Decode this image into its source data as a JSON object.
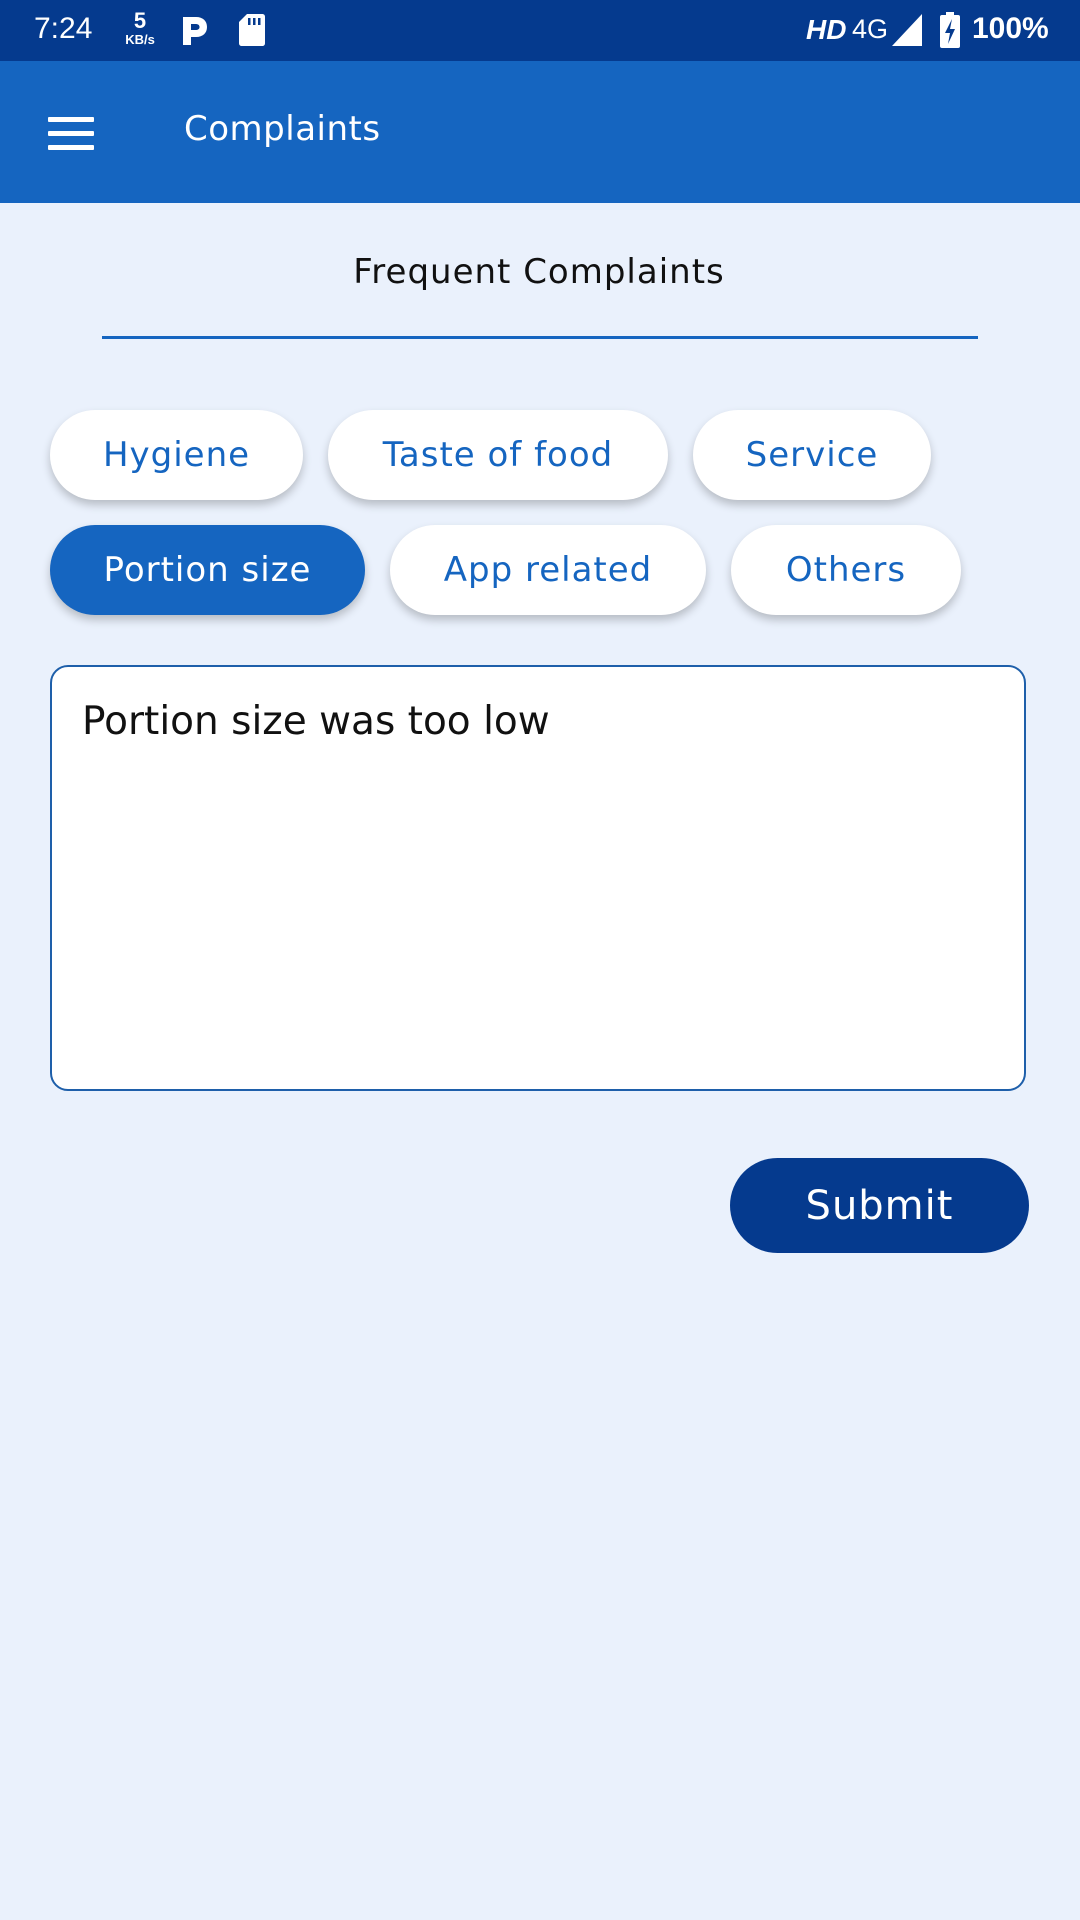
{
  "status_bar": {
    "time": "7:24",
    "net_speed_value": "5",
    "net_speed_unit": "KB/s",
    "hd_label": "HD",
    "network_type": "4G",
    "battery_percent": "100%",
    "icons": [
      "parking-app-icon",
      "sd-card-icon",
      "cell-signal-icon",
      "battery-charging-icon"
    ]
  },
  "app_bar": {
    "menu_icon": "hamburger-menu-icon",
    "title": "Complaints",
    "background_color": "#1565C0"
  },
  "section": {
    "title": "Frequent Complaints"
  },
  "chips": [
    {
      "label": "Hygiene",
      "selected": false
    },
    {
      "label": "Taste of food",
      "selected": false
    },
    {
      "label": "Service",
      "selected": false
    },
    {
      "label": "Portion size",
      "selected": true
    },
    {
      "label": "App related",
      "selected": false
    },
    {
      "label": "Others",
      "selected": false
    }
  ],
  "complaint_input": {
    "value": "Portion size was too low"
  },
  "submit": {
    "label": "Submit",
    "color": "#053A8E"
  },
  "colors": {
    "status_bar": "#053A8E",
    "primary": "#1565C0",
    "page_background": "#EAF1FC",
    "chip_background": "#FFFFFF"
  }
}
